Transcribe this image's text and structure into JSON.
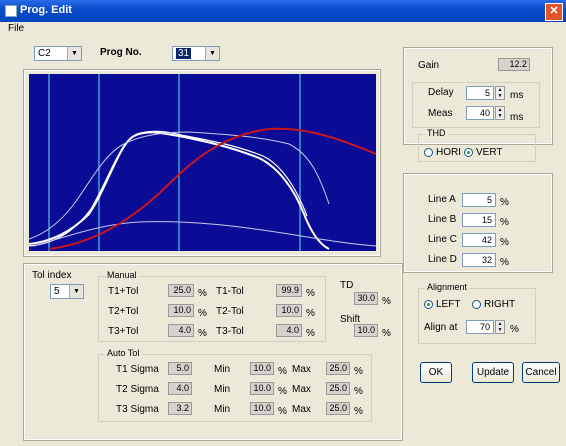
{
  "window": {
    "title": "Prog. Edit",
    "close_glyph": "✕"
  },
  "menu": {
    "file": "File"
  },
  "top": {
    "channel_value": "C2",
    "prog_label": "Prog No.",
    "prog_value": "31"
  },
  "right_panel": {
    "gain_label": "Gain",
    "gain_value": "12.2",
    "delay_label": "Delay",
    "delay_value": "5",
    "delay_unit": "ms",
    "meas_label": "Meas",
    "meas_value": "40",
    "meas_unit": "ms",
    "thd_title": "THD",
    "thd_hori": "HORI",
    "thd_vert": "VERT",
    "thd_selected": "VERT",
    "lines": [
      {
        "label": "Line A",
        "value": "5",
        "unit": "%"
      },
      {
        "label": "Line B",
        "value": "15",
        "unit": "%"
      },
      {
        "label": "Line C",
        "value": "42",
        "unit": "%"
      },
      {
        "label": "Line D",
        "value": "32",
        "unit": "%"
      }
    ],
    "align_title": "Alignment",
    "align_left": "LEFT",
    "align_right": "RIGHT",
    "align_selected": "LEFT",
    "align_at_label": "Align at",
    "align_at_value": "70",
    "align_at_unit": "%"
  },
  "buttons": {
    "ok": "OK",
    "update": "Update",
    "cancel": "Cancel"
  },
  "tol": {
    "label": "Tol index",
    "value": "5"
  },
  "manual": {
    "title": "Manual",
    "rows": [
      {
        "plus_label": "T1+Tol",
        "plus_val": "25.0",
        "minus_label": "T1-Tol",
        "minus_val": "99.9"
      },
      {
        "plus_label": "T2+Tol",
        "plus_val": "10.0",
        "minus_label": "T2-Tol",
        "minus_val": "10.0"
      },
      {
        "plus_label": "T3+Tol",
        "plus_val": "4.0",
        "minus_label": "T3-Tol",
        "minus_val": "4.0"
      }
    ],
    "unit": "%"
  },
  "td": {
    "label": "TD",
    "value": "30.0",
    "shift_label": "Shift",
    "shift_value": "10.0",
    "unit": "%"
  },
  "auto": {
    "title": "Auto Tol",
    "min_label": "Min",
    "max_label": "Max",
    "unit": "%",
    "rows": [
      {
        "label": "T1 Sigma",
        "val": "5.0",
        "min": "10.0",
        "max": "25.0"
      },
      {
        "label": "T2 Sigma",
        "val": "4.0",
        "min": "10.0",
        "max": "25.0"
      },
      {
        "label": "T3 Sigma",
        "val": "3.2",
        "min": "10.0",
        "max": "25.0"
      }
    ]
  },
  "colors": {
    "plot_bg": "#0a0c96",
    "vline": "#3aa0d8",
    "curve_white": "#ffffff",
    "curve_light": "#c8c8f0",
    "curve_red": "#c8141e"
  }
}
